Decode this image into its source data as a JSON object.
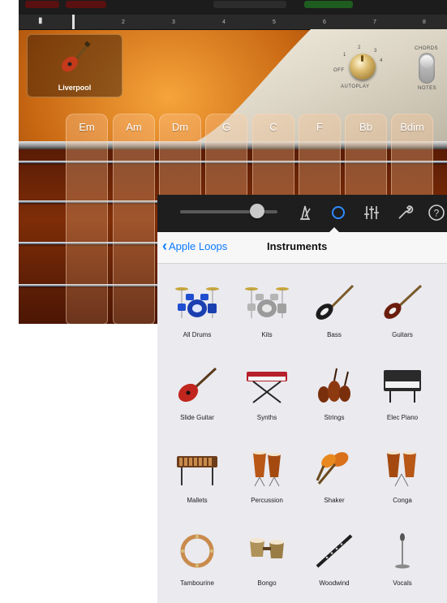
{
  "background_app": {
    "instrument_card": {
      "name": "Liverpool"
    },
    "ruler_ticks": [
      "1",
      "2",
      "3",
      "4",
      "5",
      "6",
      "7",
      "8"
    ],
    "autoplay": {
      "label": "AUTOPLAY",
      "off_label": "OFF",
      "positions": [
        "1",
        "2",
        "3",
        "4"
      ]
    },
    "mode_switch": {
      "top_label": "CHORDS",
      "bottom_label": "NOTES"
    },
    "chords": [
      "Em",
      "Am",
      "Dm",
      "G",
      "C",
      "F",
      "Bb",
      "Bdim"
    ]
  },
  "popover": {
    "toolbar": {
      "icons": [
        "volume-slider",
        "metronome-icon",
        "instruments-icon",
        "mixer-icon",
        "wrench-icon",
        "help-icon"
      ]
    },
    "navbar": {
      "back_label": "Apple Loops",
      "title": "Instruments"
    },
    "instruments": [
      {
        "label": "All Drums",
        "icon": "drum-kit-icon"
      },
      {
        "label": "Kits",
        "icon": "drum-kit-silver-icon"
      },
      {
        "label": "Bass",
        "icon": "bass-guitar-icon"
      },
      {
        "label": "Guitars",
        "icon": "electric-guitar-icon"
      },
      {
        "label": "Slide Guitar",
        "icon": "slide-guitar-icon"
      },
      {
        "label": "Synths",
        "icon": "synth-keyboard-icon"
      },
      {
        "label": "Strings",
        "icon": "violin-icon"
      },
      {
        "label": "Elec Piano",
        "icon": "electric-piano-icon"
      },
      {
        "label": "Mallets",
        "icon": "marimba-icon"
      },
      {
        "label": "Percussion",
        "icon": "congas-icon"
      },
      {
        "label": "Shaker",
        "icon": "maracas-icon"
      },
      {
        "label": "Conga",
        "icon": "conga-icon"
      },
      {
        "label": "Tambourine",
        "icon": "tambourine-icon"
      },
      {
        "label": "Bongo",
        "icon": "bongo-icon"
      },
      {
        "label": "Woodwind",
        "icon": "clarinet-icon"
      },
      {
        "label": "Vocals",
        "icon": "microphone-icon"
      }
    ]
  },
  "colors": {
    "accent": "#0a7aff",
    "toolbar_bg": "#1e1e1e",
    "sheet_bg": "#eaeaef"
  }
}
